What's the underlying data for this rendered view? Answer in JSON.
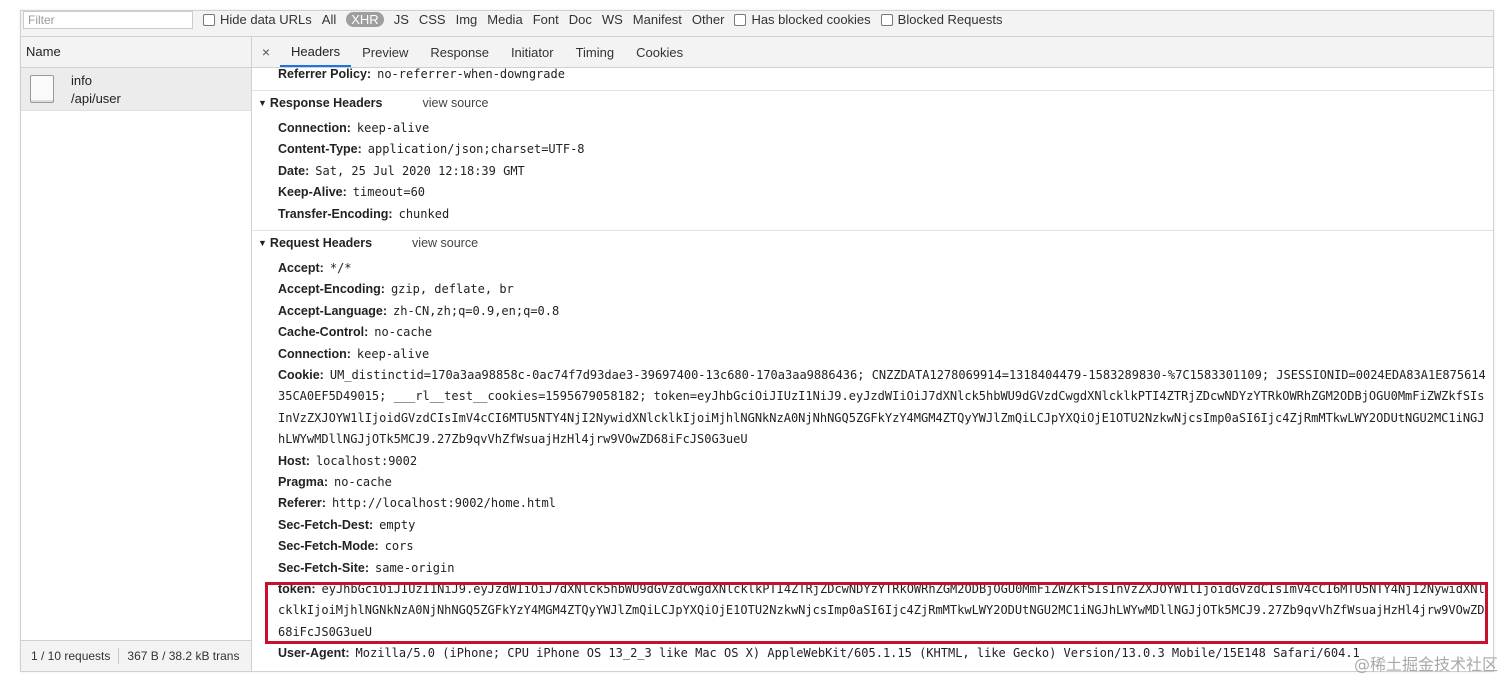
{
  "filter_bar": {
    "filter_placeholder": "Filter",
    "hide_data_urls_label": "Hide data URLs",
    "types": [
      "All",
      "XHR",
      "JS",
      "CSS",
      "Img",
      "Media",
      "Font",
      "Doc",
      "WS",
      "Manifest",
      "Other"
    ],
    "active_type": "XHR",
    "has_blocked_cookies_label": "Has blocked cookies",
    "blocked_requests_label": "Blocked Requests"
  },
  "left_panel": {
    "name_header": "Name",
    "request": {
      "name": "info",
      "path": "/api/user"
    },
    "status": {
      "requests": "1 / 10 requests",
      "transferred": "367 B / 38.2 kB trans"
    }
  },
  "tabs": {
    "close": "×",
    "items": [
      "Headers",
      "Preview",
      "Response",
      "Initiator",
      "Timing",
      "Cookies"
    ],
    "active": "Headers"
  },
  "top_row": {
    "key": "Referrer Policy:",
    "value": "no-referrer-when-downgrade"
  },
  "response_headers": {
    "title": "Response Headers",
    "view_source": "view source",
    "rows": [
      {
        "key": "Connection:",
        "value": "keep-alive"
      },
      {
        "key": "Content-Type:",
        "value": "application/json;charset=UTF-8"
      },
      {
        "key": "Date:",
        "value": "Sat, 25 Jul 2020 12:18:39 GMT"
      },
      {
        "key": "Keep-Alive:",
        "value": "timeout=60"
      },
      {
        "key": "Transfer-Encoding:",
        "value": "chunked"
      }
    ]
  },
  "request_headers": {
    "title": "Request Headers",
    "view_source": "view source",
    "rows": [
      {
        "key": "Accept:",
        "value": "*/*"
      },
      {
        "key": "Accept-Encoding:",
        "value": "gzip, deflate, br"
      },
      {
        "key": "Accept-Language:",
        "value": "zh-CN,zh;q=0.9,en;q=0.8"
      },
      {
        "key": "Cache-Control:",
        "value": "no-cache"
      },
      {
        "key": "Connection:",
        "value": "keep-alive"
      },
      {
        "key": "Cookie:",
        "value": "UM_distinctid=170a3aa98858c-0ac74f7d93dae3-39697400-13c680-170a3aa9886436; CNZZDATA1278069914=1318404479-1583289830-%7C1583301109; JSESSIONID=0024EDA83A1E87561435CA0EF5D49015; ___rl__test__cookies=1595679058182; token=eyJhbGciOiJIUzI1NiJ9.eyJzdWIiOiJ7dXNlck5hbWU9dGVzdCwgdXNlcklkPTI4ZTRjZDcwNDYzYTRkOWRhZGM2ODBjOGU0MmFiZWZkfSIsInVzZXJOYW1lIjoidGVzdCIsImV4cCI6MTU5NTY4NjI2NywidXNlcklkIjoiMjhlNGNkNzA0NjNhNGQ5ZGFkYzY4MGM4ZTQyYWJlZmQiLCJpYXQiOjE1OTU2NzkwNjcsImp0aSI6Ijc4ZjRmMTkwLWY2ODUtNGU2MC1iNGJhLWYwMDllNGJjOTk5MCJ9.27Zb9qvVhZfWsuajHzHl4jrw9VOwZD68iFcJS0G3ueU"
      },
      {
        "key": "Host:",
        "value": "localhost:9002"
      },
      {
        "key": "Pragma:",
        "value": "no-cache"
      },
      {
        "key": "Referer:",
        "value": "http://localhost:9002/home.html"
      },
      {
        "key": "Sec-Fetch-Dest:",
        "value": "empty"
      },
      {
        "key": "Sec-Fetch-Mode:",
        "value": "cors"
      },
      {
        "key": "Sec-Fetch-Site:",
        "value": "same-origin"
      },
      {
        "key": "token:",
        "value": "eyJhbGciOiJIUzI1NiJ9.eyJzdWIiOiJ7dXNlck5hbWU9dGVzdCwgdXNlcklkPTI4ZTRjZDcwNDYzYTRkOWRhZGM2ODBjOGU0MmFiZWZkfSIsInVzZXJOYW1lIjoidGVzdCIsImV4cCI6MTU5NTY4NjI2NywidXNlcklkIjoiMjhlNGNkNzA0NjNhNGQ5ZGFkYzY4MGM4ZTQyYWJlZmQiLCJpYXQiOjE1OTU2NzkwNjcsImp0aSI6Ijc4ZjRmMTkwLWY2ODUtNGU2MC1iNGJhLWYwMDllNGJjOTk5MCJ9.27Zb9qvVhZfWsuajHzHl4jrw9VOwZD68iFcJS0G3ueU"
      },
      {
        "key": "User-Agent:",
        "value": "Mozilla/5.0 (iPhone; CPU iPhone OS 13_2_3 like Mac OS X) AppleWebKit/605.1.15 (KHTML, like Gecko) Version/13.0.3 Mobile/15E148 Safari/604.1"
      }
    ]
  },
  "highlight_color": "#c8102e",
  "watermark": "@稀土掘金技术社区"
}
